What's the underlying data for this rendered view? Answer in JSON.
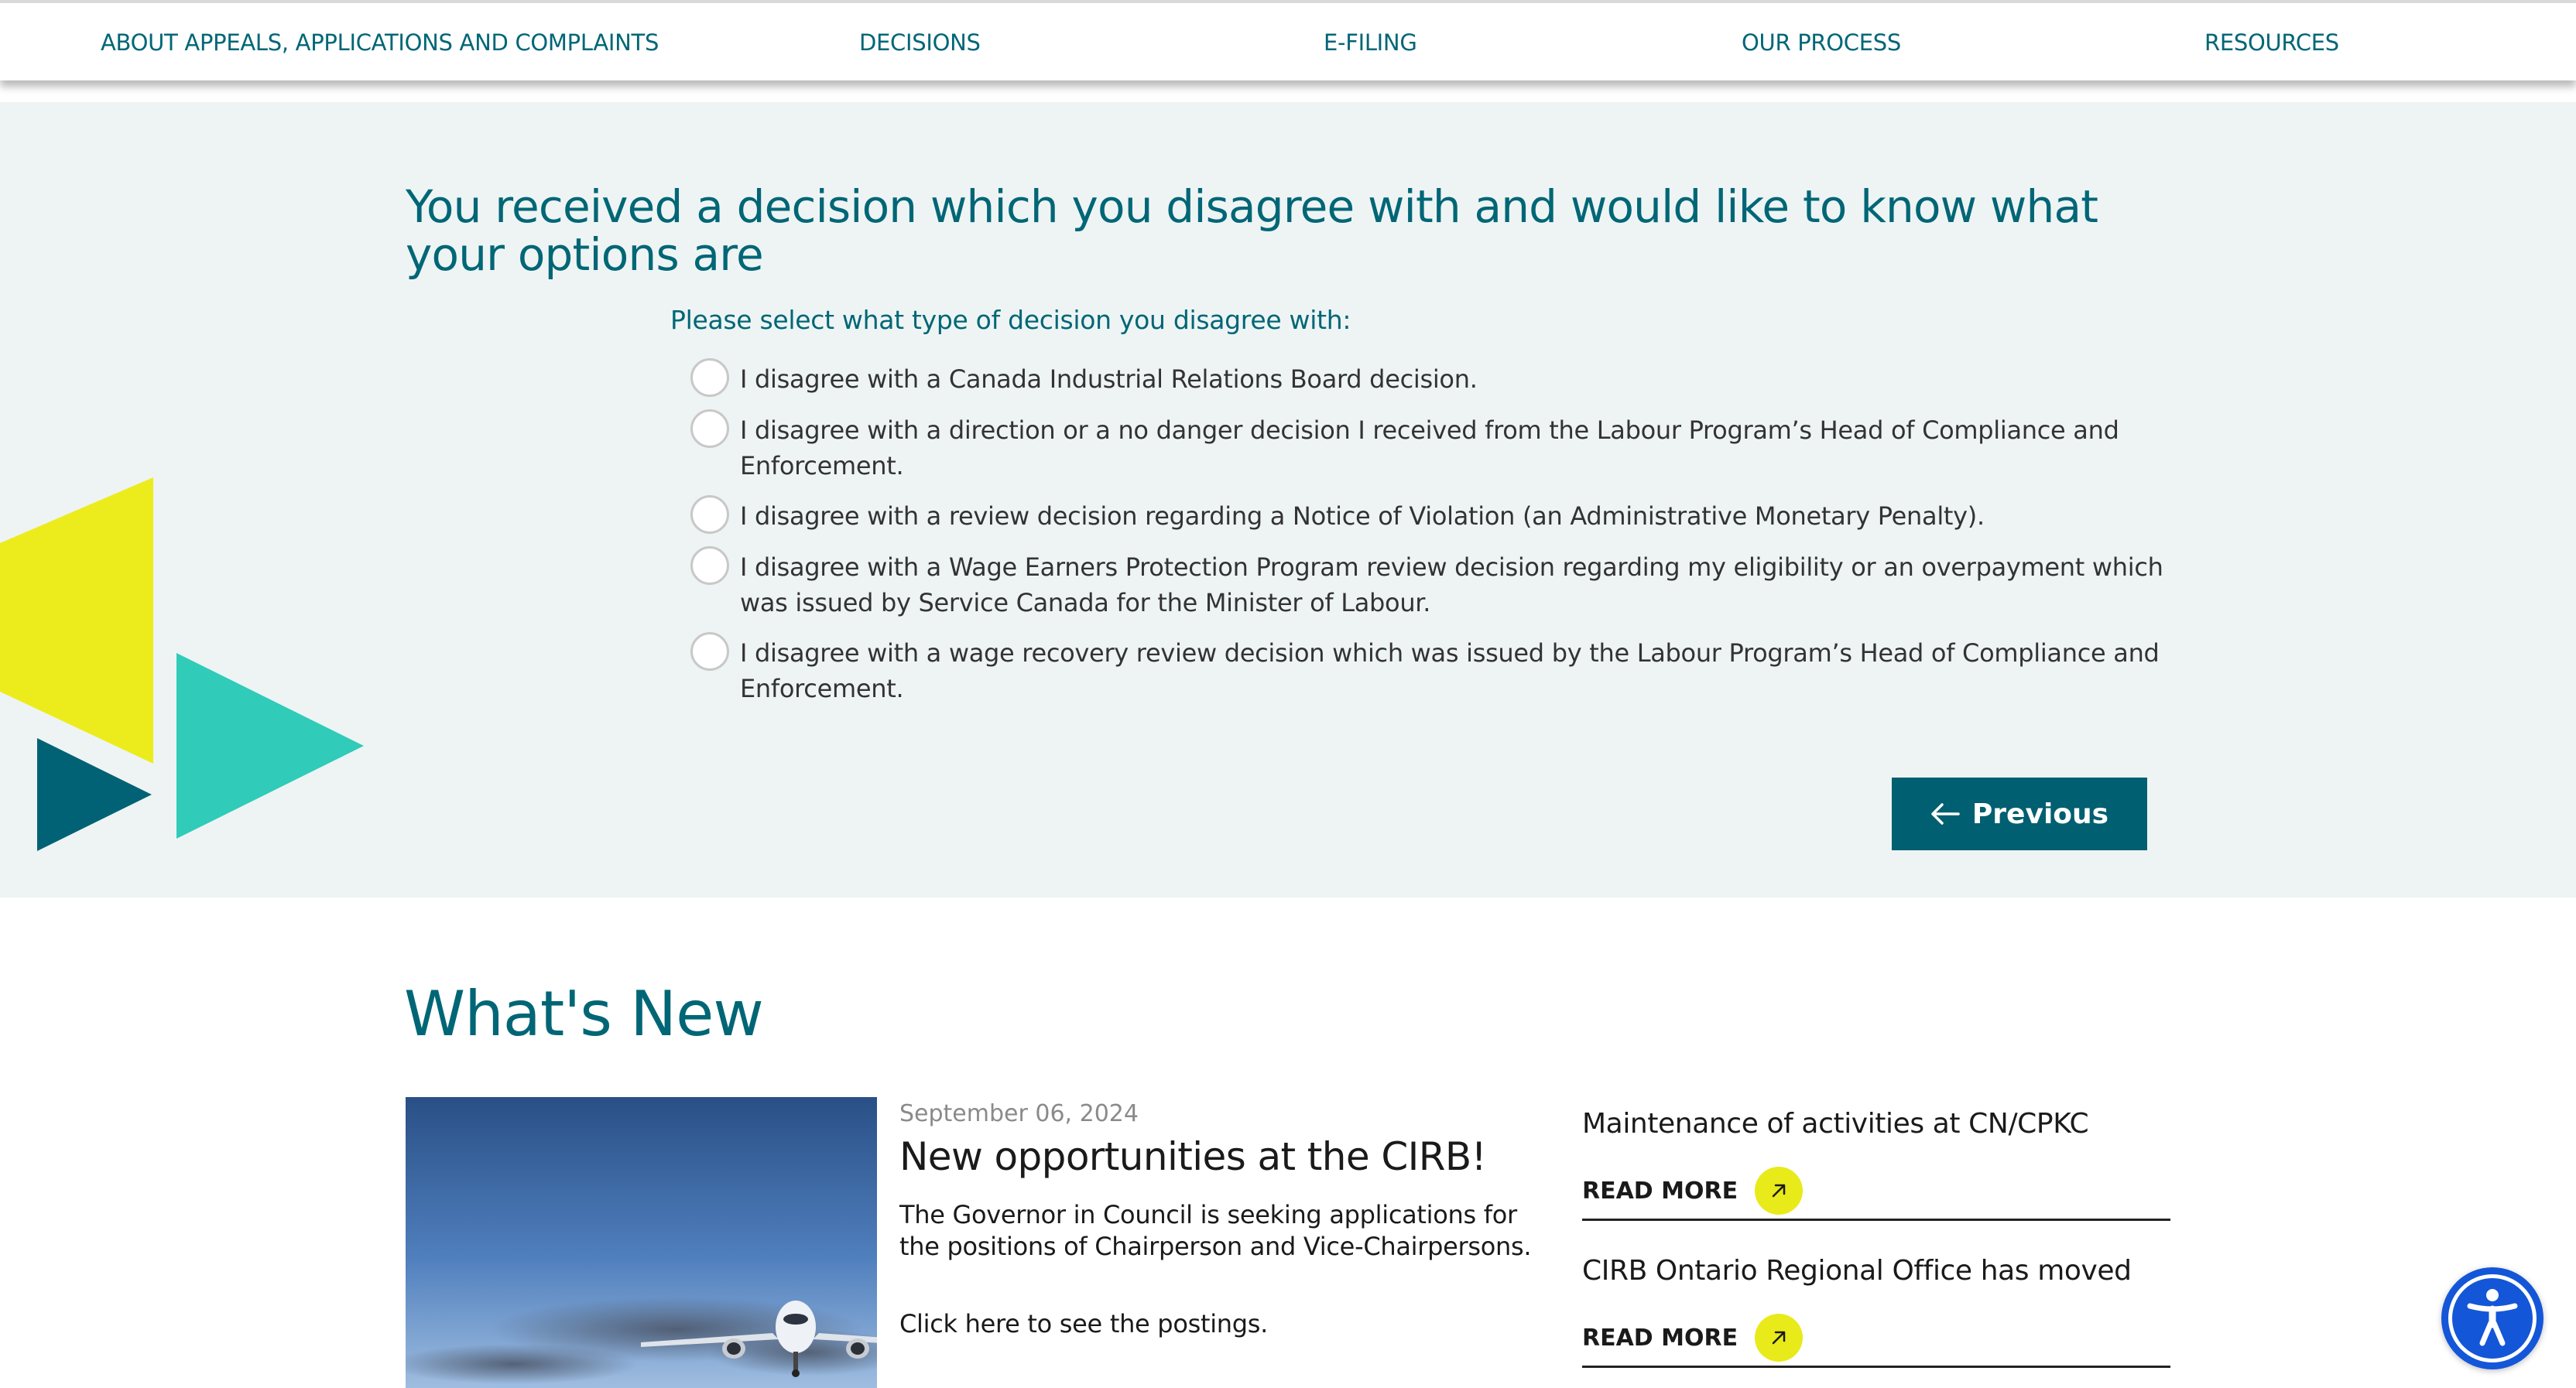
{
  "nav": {
    "items": [
      "ABOUT APPEALS, APPLICATIONS AND COMPLAINTS",
      "DECISIONS",
      "E-FILING",
      "OUR PROCESS",
      "RESOURCES"
    ]
  },
  "question": {
    "title": "You received a decision which you disagree with and would like to know what your options are",
    "subtitle": "Please select what type of decision you disagree with:",
    "options": [
      "I disagree with a Canada Industrial Relations Board decision.",
      "I disagree with a direction or a no danger decision I received from the Labour Program’s Head of Compliance and Enforcement.",
      "I disagree with a review decision regarding a Notice of Violation (an Administrative Monetary Penalty).",
      "I disagree with a Wage Earners Protection Program review decision regarding my eligibility or an overpayment which was issued by Service Canada for the Minister of Labour.",
      "I disagree with a wage recovery review decision which was issued by the Labour Program’s Head of Compliance and Enforcement."
    ],
    "previous_label": "Previous"
  },
  "whats_new": {
    "title": "What's New",
    "featured": {
      "date": "September 06, 2024",
      "headline": "New opportunities at the CIRB!",
      "summary": "The Governor in Council is seeking applications for the positions of Chairperson and Vice-Chairpersons.",
      "link_text": "Click here to see the postings."
    },
    "side_items": [
      {
        "title": "Maintenance of activities at CN/CPKC",
        "read_more": "READ MORE"
      },
      {
        "title": "CIRB Ontario Regional Office has moved",
        "read_more": "READ MORE"
      }
    ]
  },
  "colors": {
    "brand_teal": "#006676",
    "button_teal": "#005f70",
    "section_bg": "#eef4f4",
    "accent_yellow": "#e8ea1a",
    "accent_aqua": "#2ecbb8",
    "a11y_blue": "#1456d8"
  },
  "icons": {
    "previous": "arrow-left-icon",
    "read_more": "arrow-up-right-icon",
    "accessibility": "accessibility-person-icon"
  }
}
